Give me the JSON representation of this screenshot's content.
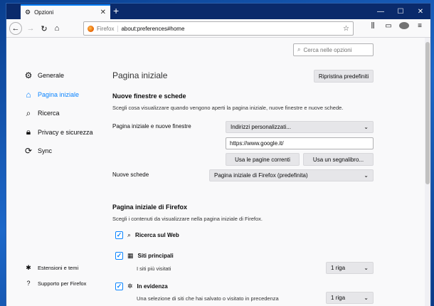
{
  "tab": {
    "title": "Opzioni",
    "close": "✕"
  },
  "newtab": "+",
  "window_controls": {
    "minimize": "—",
    "maximize": "☐",
    "close": "✕"
  },
  "urlbar": {
    "identity": "Firefox",
    "url": "about:preferences#home"
  },
  "search_prefs": {
    "placeholder": "Cerca nelle opzioni"
  },
  "sidebar": {
    "items": [
      {
        "label": "Generale",
        "icon": "gear-icon"
      },
      {
        "label": "Pagina iniziale",
        "icon": "home-icon"
      },
      {
        "label": "Ricerca",
        "icon": "search-icon"
      },
      {
        "label": "Privacy e sicurezza",
        "icon": "lock-icon"
      },
      {
        "label": "Sync",
        "icon": "sync-icon"
      }
    ],
    "bottom": [
      {
        "label": "Estensioni e temi",
        "icon": "puzzle-icon"
      },
      {
        "label": "Supporto per Firefox",
        "icon": "help-icon"
      }
    ]
  },
  "main": {
    "title": "Pagina iniziale",
    "restore_button": "Ripristina predefiniti",
    "section1": {
      "heading": "Nuove finestre e schede",
      "description": "Scegli cosa visualizzare quando vengono aperti la pagina iniziale, nuove finestre e nuove schede.",
      "home_label": "Pagina iniziale e nuove finestre",
      "home_select": "Indirizzi personalizzati...",
      "home_url": "https://www.google.it/",
      "use_current": "Usa le pagine correnti",
      "use_bookmark": "Usa un segnalibro...",
      "newtab_label": "Nuove schede",
      "newtab_select": "Pagina iniziale di Firefox (predefinita)"
    },
    "section2": {
      "heading": "Pagina iniziale di Firefox",
      "description": "Scegli i contenuti da visualizzare nella pagina iniziale di Firefox.",
      "web_search": "Ricerca sul Web",
      "top_sites": "Siti principali",
      "top_sites_desc": "I siti più visitati",
      "top_sites_rows": "1 riga",
      "highlights": "In evidenza",
      "highlights_desc": "Una selezione di siti che hai salvato o visitato in precedenza",
      "highlights_rows": "1 riga"
    }
  }
}
